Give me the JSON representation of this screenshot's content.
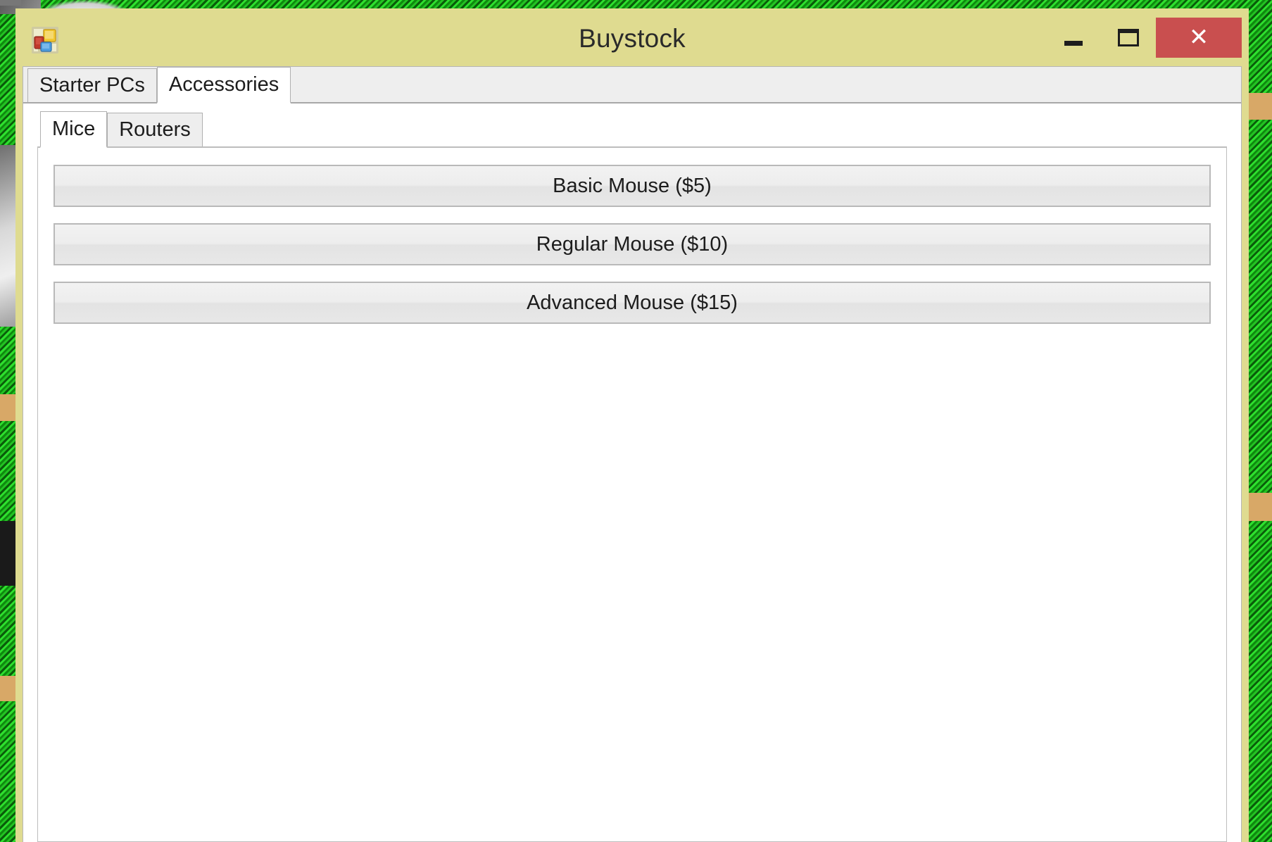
{
  "desktop": {
    "wallpaper_color": "#19a019",
    "wallpaper_stripe_color": "#0f8a0f"
  },
  "window": {
    "title": "Buystock",
    "frame_color": "#dfdb90",
    "icon_name": "winforms-app-icon",
    "controls": {
      "minimize_label": "–",
      "maximize_label": "□",
      "close_label": "✕",
      "close_color": "#c94f4f"
    }
  },
  "outer_tabs": {
    "items": [
      {
        "label": "Starter PCs",
        "active": false
      },
      {
        "label": "Accessories",
        "active": true
      }
    ]
  },
  "inner_tabs": {
    "items": [
      {
        "label": "Mice",
        "active": true
      },
      {
        "label": "Routers",
        "active": false
      }
    ]
  },
  "products": {
    "items": [
      {
        "label": "Basic Mouse ($5)"
      },
      {
        "label": "Regular Mouse ($10)"
      },
      {
        "label": "Advanced Mouse ($15)"
      }
    ]
  }
}
